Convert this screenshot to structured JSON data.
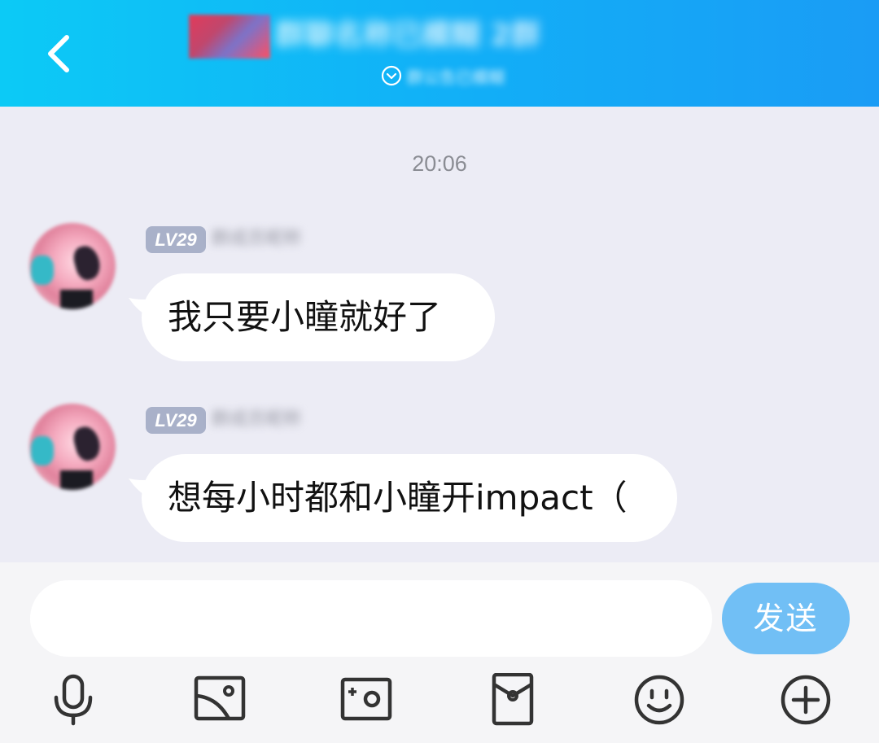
{
  "header": {
    "title": "群聊名称已模糊 2群",
    "subtitle": "群公告已模糊"
  },
  "chat": {
    "timestamp": "20:06",
    "messages": [
      {
        "level": "LV29",
        "nickname": "群成员昵称",
        "text": "我只要小瞳就好了"
      },
      {
        "level": "LV29",
        "nickname": "群成员昵称",
        "text": "想每小时都和小瞳开impact（"
      }
    ]
  },
  "input": {
    "value": "",
    "send_label": "发送"
  },
  "toolbar": {
    "icons": [
      "microphone-icon",
      "image-icon",
      "camera-icon",
      "red-packet-icon",
      "emoji-icon",
      "plus-icon"
    ]
  },
  "colors": {
    "header_start": "#0ccaf6",
    "header_end": "#1a9cf5",
    "chat_background": "#ececf5",
    "send_button": "#71bff5",
    "level_badge": "#a9b1c9"
  }
}
